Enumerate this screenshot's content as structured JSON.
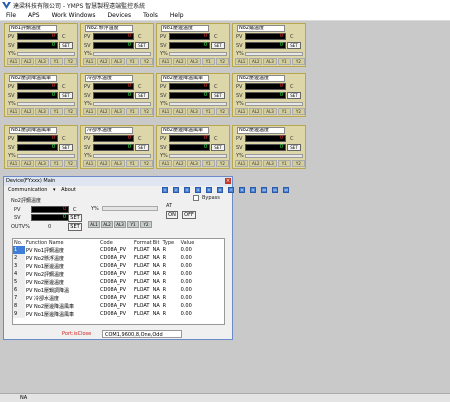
{
  "window": {
    "title": "達梁科技有限公司 - YMPS 智慧製程遠端監控系統"
  },
  "menu": [
    "File",
    "APS",
    "Work Windows",
    "Devices",
    "Tools",
    "Help"
  ],
  "panels": [
    {
      "title": "No1評鋼溫度",
      "pv": "0",
      "sv": "0",
      "unit": "C",
      "set": "SET",
      "alarms": [
        "AL1",
        "AL2",
        "AL3",
        "Y1",
        "Y2"
      ]
    },
    {
      "title": "No2.懸浮溫度",
      "pv": "0",
      "sv": "0",
      "unit": "C",
      "set": "SET",
      "alarms": [
        "AL1",
        "AL2",
        "AL3",
        "Y1",
        "Y2"
      ]
    },
    {
      "title": "No1壓邊溫度",
      "pv": "0",
      "sv": "0",
      "unit": "C",
      "set": "SET",
      "alarms": [
        "AL1",
        "AL2",
        "AL3",
        "Y1",
        "Y2"
      ]
    },
    {
      "title": "No2鐵溫度",
      "pv": "0",
      "sv": "0",
      "unit": "C",
      "set": "SET",
      "alarms": [
        "AL1",
        "AL2",
        "AL3",
        "Y1",
        "Y2"
      ]
    },
    {
      "title": "No2壓調降溫風車",
      "pv": "0",
      "sv": "0",
      "unit": "C",
      "set": "SET",
      "alarms": [
        "AL1",
        "AL2",
        "AL3",
        "Y1",
        "Y2"
      ]
    },
    {
      "title": "冷卻水溫度",
      "pv": "0",
      "sv": "0",
      "unit": "C",
      "set": "SET",
      "alarms": [
        "AL1",
        "AL2",
        "AL3",
        "Y1",
        "Y2"
      ]
    },
    {
      "title": "No2壓邊降溫風車",
      "pv": "0",
      "sv": "0",
      "unit": "C",
      "set": "SET",
      "alarms": [
        "AL1",
        "AL2",
        "AL3",
        "Y1",
        "Y2"
      ]
    },
    {
      "title": "No2壓邊溫度",
      "pv": "0",
      "sv": "0",
      "unit": "C",
      "set": "SET",
      "alarms": [
        "AL1",
        "AL2",
        "AL3",
        "Y1",
        "Y2"
      ]
    },
    {
      "title": "No1壓調降溫風車",
      "pv": "0",
      "sv": "0",
      "unit": "C",
      "set": "SET",
      "alarms": [
        "AL1",
        "AL2",
        "AL3",
        "Y1",
        "Y2"
      ]
    },
    {
      "title": "冷卻水溫度",
      "pv": "0",
      "sv": "0",
      "unit": "C",
      "set": "SET",
      "alarms": [
        "AL1",
        "AL2",
        "AL3",
        "Y1",
        "Y2"
      ]
    },
    {
      "title": "No2壓邊降溫風車",
      "pv": "0",
      "sv": "0",
      "unit": "C",
      "set": "SET",
      "alarms": [
        "AL1",
        "AL2",
        "AL3",
        "Y1",
        "Y2"
      ]
    },
    {
      "title": "No2壓邊溫度",
      "pv": "0",
      "sv": "0",
      "unit": "C",
      "set": "SET",
      "alarms": [
        "AL1",
        "AL2",
        "AL3",
        "Y1",
        "Y2"
      ]
    }
  ],
  "labels": {
    "pv": "PV",
    "sv": "SV",
    "y": "Y%"
  },
  "dialog": {
    "title": "Device(FYxxx) Main",
    "menu_comm": "Communication",
    "menu_about": "About",
    "device_buttons": [
      "1",
      "2",
      "3",
      "4",
      "5",
      "6",
      "7",
      "8",
      "9",
      "10",
      "11",
      "12"
    ],
    "name": "No2評鋼溫度",
    "pv_label": "PV",
    "sv_label": "SV",
    "pv": "0",
    "sv": "0",
    "unit": "C",
    "set": "SET",
    "outv_label": "OUTV%",
    "outv": "0",
    "set2": "SET",
    "y_label": "Y%",
    "at_label": "AT",
    "on": "ON",
    "off": "OFF",
    "bypass": "Bypass",
    "alarms": [
      "AL1",
      "AL2",
      "AL3",
      "Y1",
      "Y2"
    ],
    "columns": [
      "No.",
      "Function Name",
      "Code",
      "Format",
      "Bit",
      "Type",
      "Value"
    ],
    "rows": [
      [
        "1",
        "PV No1評鋼溫度",
        "CD08A_PV",
        "FLOAT",
        "NA",
        "R",
        "0.00"
      ],
      [
        "2",
        "PV No2懸浮溫度",
        "CD08A_PV",
        "FLOAT",
        "NA",
        "R",
        "0.00"
      ],
      [
        "3",
        "PV No1壓邊溫度",
        "CD08A_PV",
        "FLOAT",
        "NA",
        "R",
        "0.00"
      ],
      [
        "4",
        "PV No2評鋼溫度",
        "CD08A_PV",
        "FLOAT",
        "NA",
        "R",
        "0.00"
      ],
      [
        "5",
        "PV No2壓邊溫度",
        "CD08A_PV",
        "FLOAT",
        "NA",
        "R",
        "0.00"
      ],
      [
        "6",
        "PV No1壓鍋調降溫",
        "CD08A_PV",
        "FLOAT",
        "NA",
        "R",
        "0.00"
      ],
      [
        "7",
        "PV 冷卻水溫度",
        "CD08A_PV",
        "FLOAT",
        "NA",
        "R",
        "0.00"
      ],
      [
        "8",
        "PV No2壓邊降溫風車",
        "CD08A_PV",
        "FLOAT",
        "NA",
        "R",
        "0.00"
      ],
      [
        "9",
        "PV No1壓邊降溫風車",
        "CD08A_PV",
        "FLOAT",
        "NA",
        "R",
        "0.00"
      ]
    ],
    "port_status": "Port:isClose",
    "com_settings": "COM1,9600,8,One,Odd"
  },
  "statusbar": {
    "text": "NA"
  },
  "colors": {
    "panel_bg": "#ddd6a8",
    "pv_color": "#ff3030",
    "sv_color": "#2fff4a",
    "selected_row": "#3f7ed8"
  }
}
